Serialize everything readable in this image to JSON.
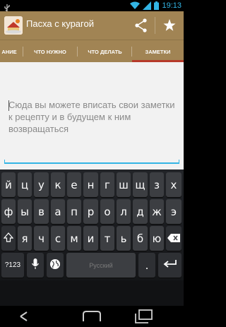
{
  "status_bar": {
    "time": "19:13"
  },
  "action_bar": {
    "title": "Пасха с курагой"
  },
  "tabs": [
    {
      "label": "АНИЕ",
      "selected": false
    },
    {
      "label": "ЧТО НУЖНО",
      "selected": false
    },
    {
      "label": "ЧТО ДЕЛАТЬ",
      "selected": false
    },
    {
      "label": "ЗАМЕТКИ",
      "selected": true
    }
  ],
  "notes": {
    "value": "",
    "placeholder": "Сюда вы можете вписать свои заметки к рецепту и в будущем к ним возвращаться"
  },
  "keyboard": {
    "row1": [
      "й",
      "ц",
      "у",
      "к",
      "е",
      "н",
      "г",
      "ш",
      "щ",
      "з",
      "х"
    ],
    "row2": [
      "ф",
      "ы",
      "в",
      "а",
      "п",
      "р",
      "о",
      "л",
      "д",
      "ж",
      "э"
    ],
    "row3": [
      "я",
      "ч",
      "с",
      "м",
      "и",
      "т",
      "ь",
      "б",
      "ю"
    ],
    "numbers_key": "?123",
    "space_label": "Русский",
    "period_key": "."
  },
  "colors": {
    "action_bar": "#a18454",
    "tab_indicator": "#b63a2a",
    "accent": "#33b5e5"
  }
}
